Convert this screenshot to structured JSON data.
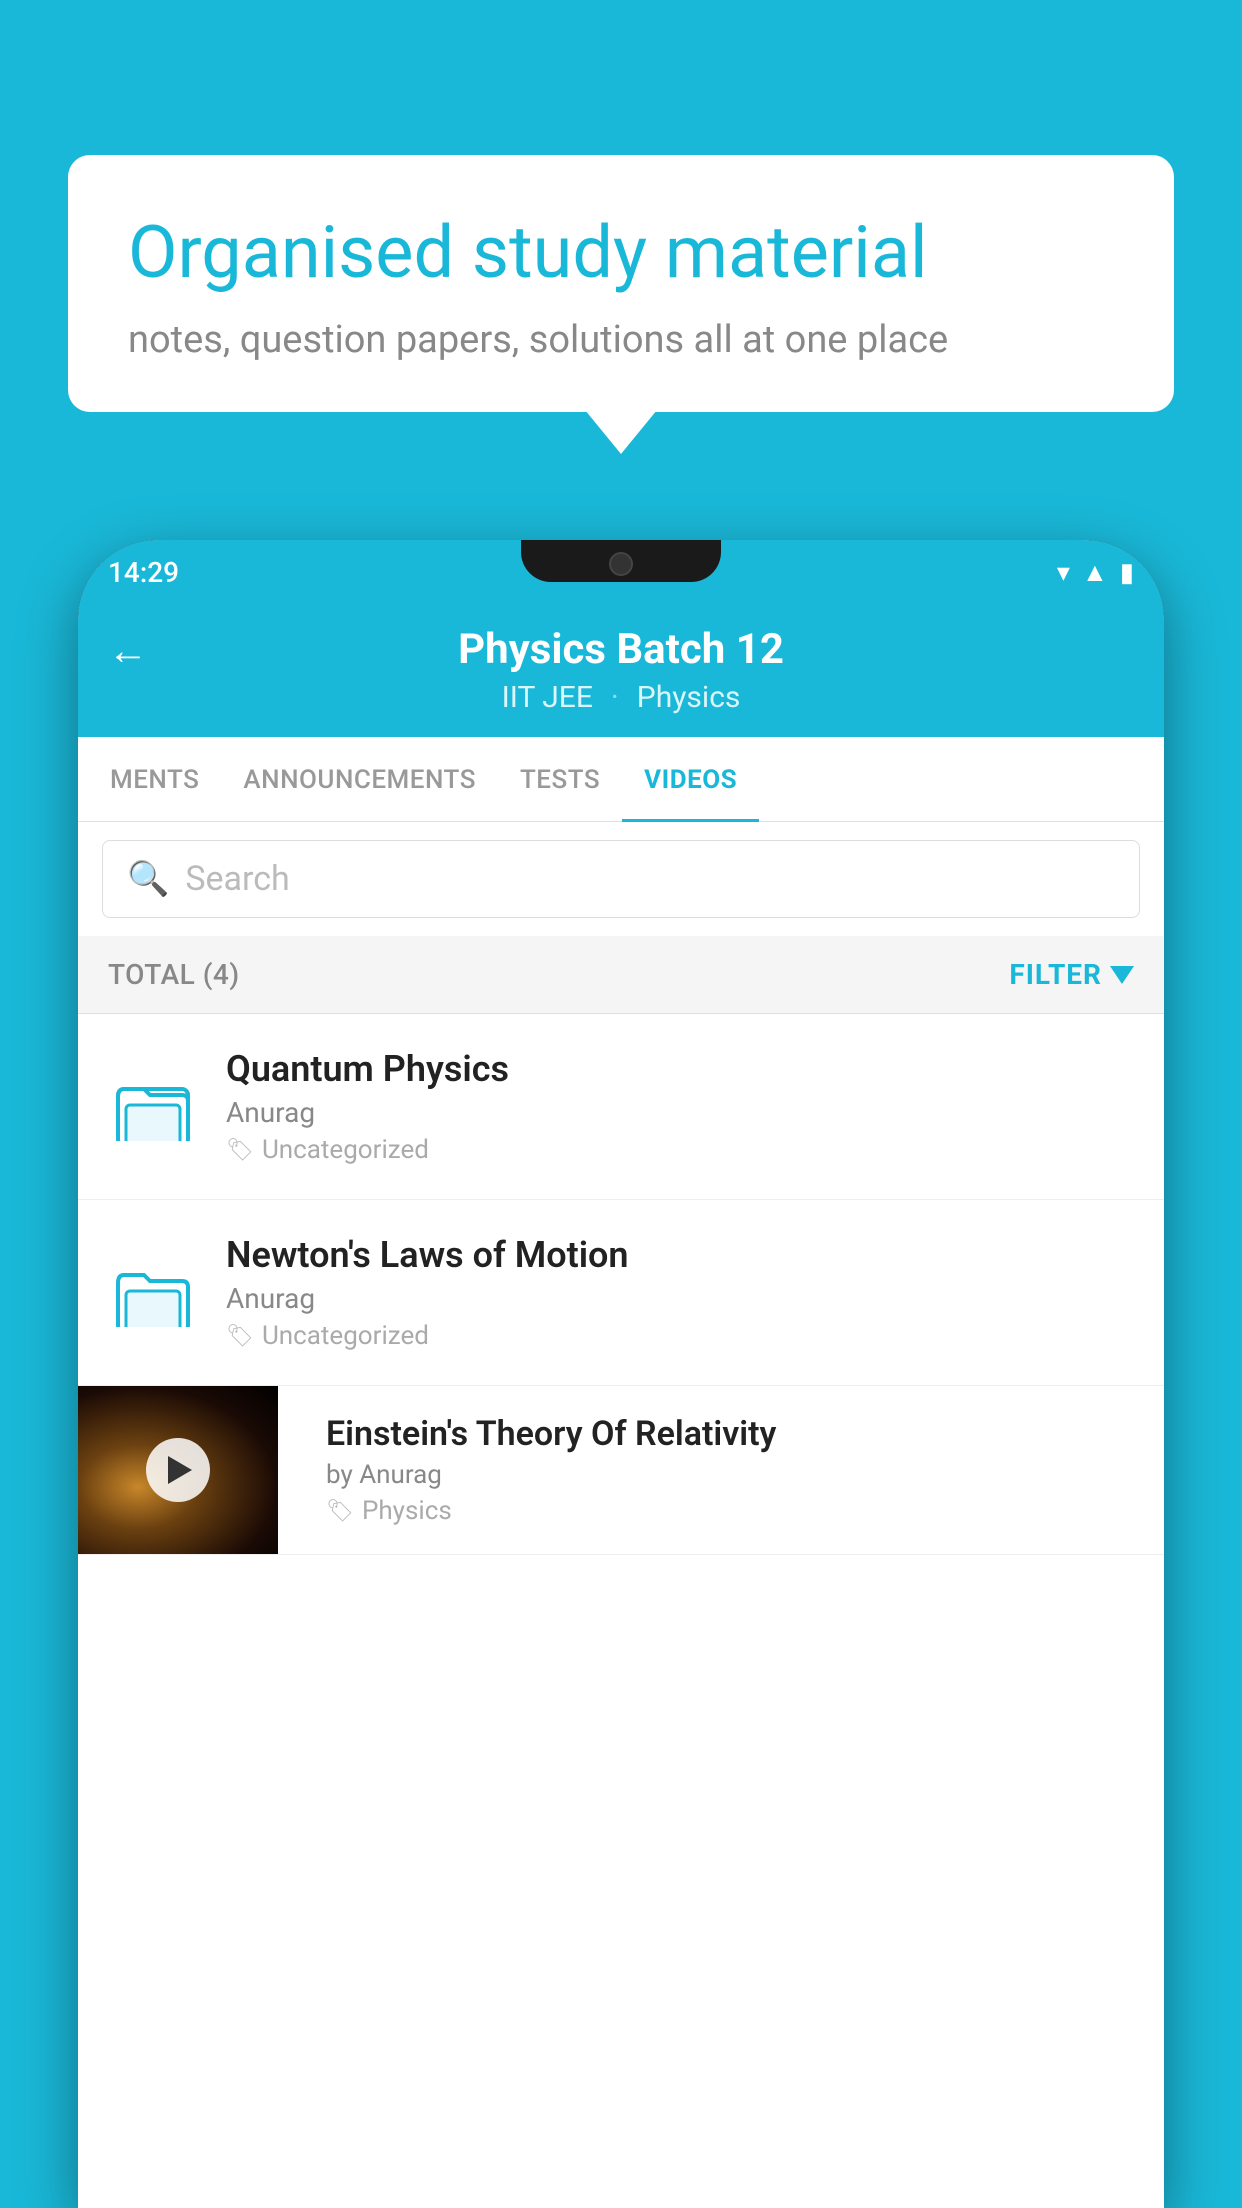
{
  "background": {
    "color": "#1ab8d8"
  },
  "bubble": {
    "title": "Organised study material",
    "subtitle": "notes, question papers, solutions all at one place"
  },
  "status_bar": {
    "time": "14:29"
  },
  "header": {
    "title": "Physics Batch 12",
    "tag1": "IIT JEE",
    "tag2": "Physics",
    "back_label": "←"
  },
  "tabs": [
    {
      "label": "MENTS",
      "active": false
    },
    {
      "label": "ANNOUNCEMENTS",
      "active": false
    },
    {
      "label": "TESTS",
      "active": false
    },
    {
      "label": "VIDEOS",
      "active": true
    }
  ],
  "search": {
    "placeholder": "Search"
  },
  "filter_bar": {
    "total_label": "TOTAL (4)",
    "filter_label": "FILTER"
  },
  "video_items": [
    {
      "id": 1,
      "title": "Quantum Physics",
      "author": "Anurag",
      "tag": "Uncategorized",
      "type": "folder"
    },
    {
      "id": 2,
      "title": "Newton's Laws of Motion",
      "author": "Anurag",
      "tag": "Uncategorized",
      "type": "folder"
    },
    {
      "id": 3,
      "title": "Einstein's Theory Of Relativity",
      "author": "by Anurag",
      "tag": "Physics",
      "type": "video"
    }
  ]
}
